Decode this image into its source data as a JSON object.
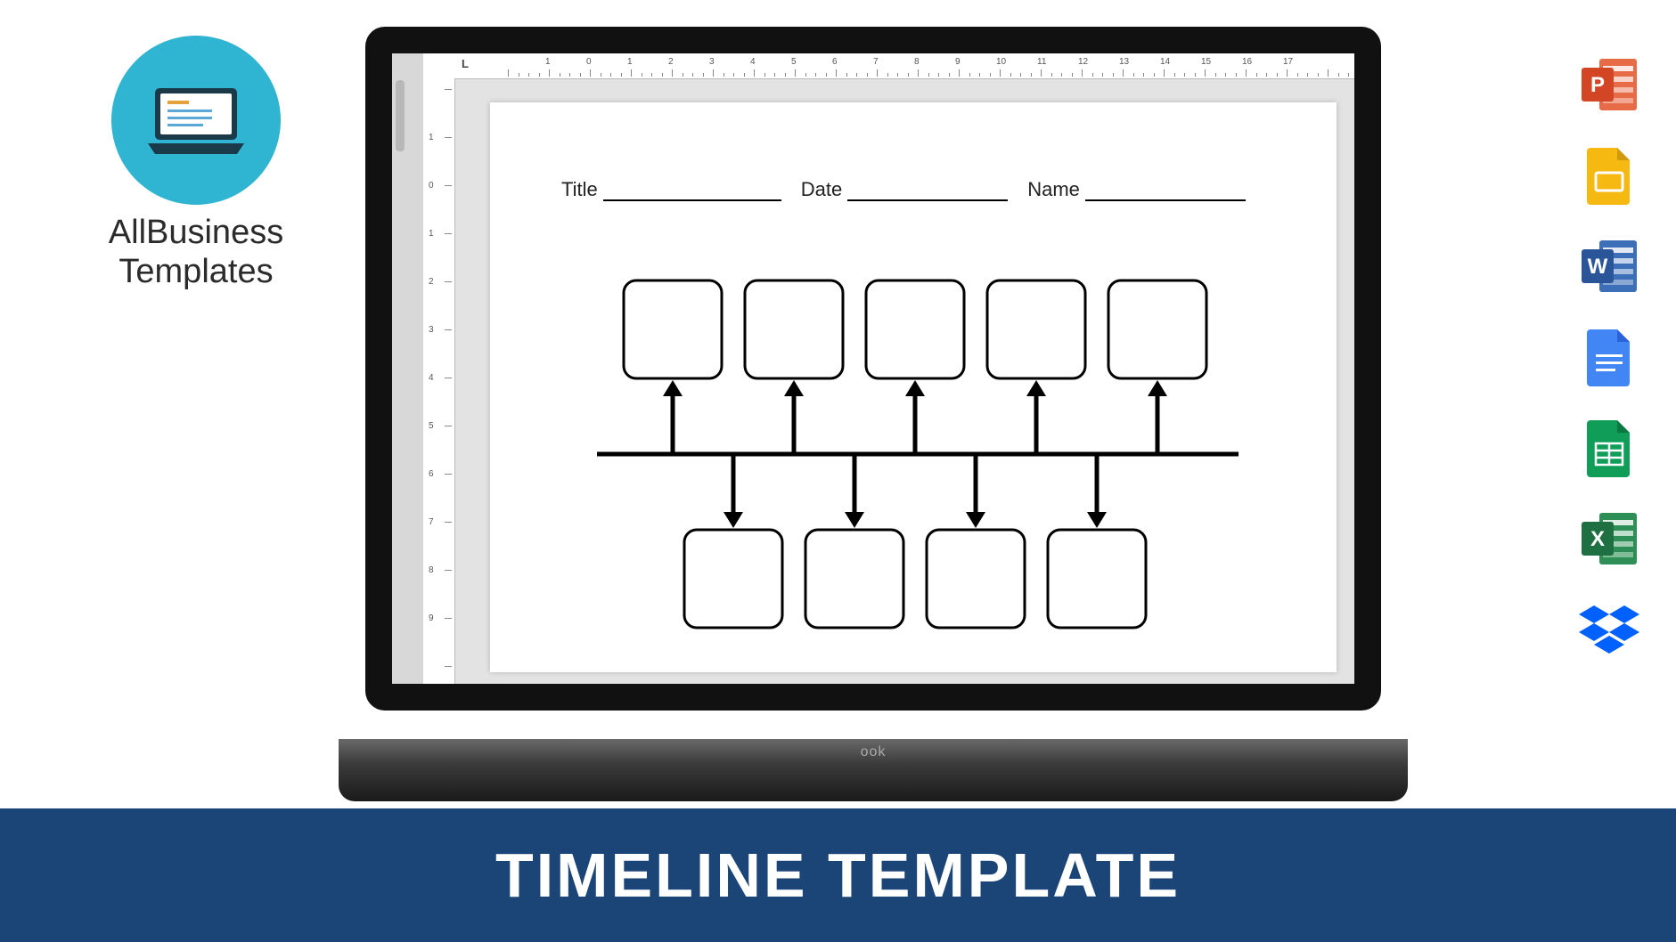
{
  "brand": {
    "line1": "AllBusiness",
    "line2": "Templates"
  },
  "banner": {
    "title": "TIMELINE TEMPLATE"
  },
  "document": {
    "header": {
      "title_label": "Title",
      "date_label": "Date",
      "name_label": "Name"
    },
    "timeline": {
      "top_boxes": 5,
      "bottom_boxes": 4
    },
    "ruler": {
      "horizontal_start": -2,
      "horizontal_end": 18,
      "vertical_start": -2,
      "vertical_end": 10,
      "corner_marker": "L"
    }
  },
  "laptop": {
    "hinge_text": "ook"
  },
  "app_icons": [
    {
      "name": "powerpoint-icon",
      "letter": "P",
      "bg": "#d24625",
      "accent": "#e86b47"
    },
    {
      "name": "google-slides-icon",
      "letter": "",
      "bg": "#f5b912",
      "accent": "#fff"
    },
    {
      "name": "word-icon",
      "letter": "W",
      "bg": "#2a5699",
      "accent": "#3d6fb8"
    },
    {
      "name": "google-docs-icon",
      "letter": "",
      "bg": "#4285f4",
      "accent": "#fff"
    },
    {
      "name": "google-sheets-icon",
      "letter": "",
      "bg": "#0f9d58",
      "accent": "#fff"
    },
    {
      "name": "excel-icon",
      "letter": "X",
      "bg": "#1e6f42",
      "accent": "#2d8f55"
    },
    {
      "name": "dropbox-icon",
      "letter": "",
      "bg": "#0061ff",
      "accent": ""
    }
  ]
}
